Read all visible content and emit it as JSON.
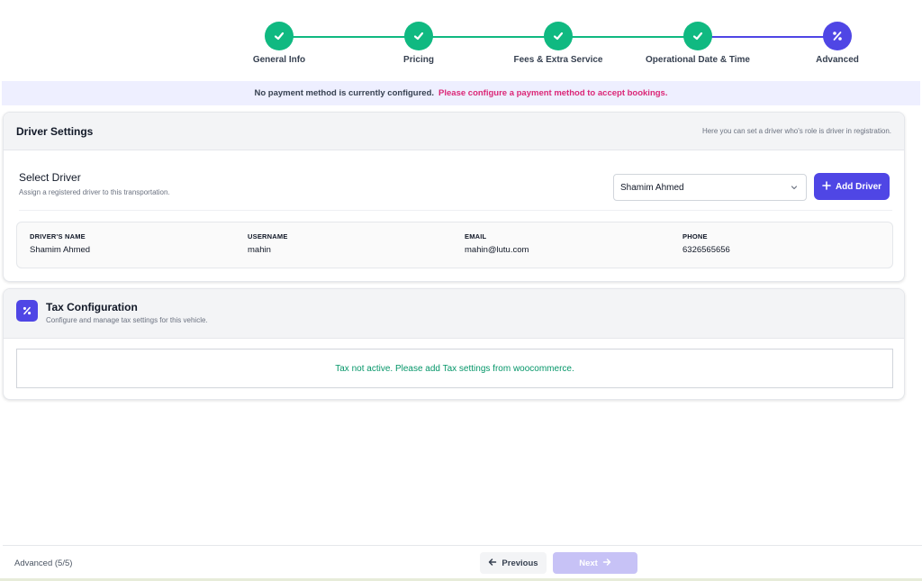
{
  "stepper": {
    "steps": [
      {
        "label": "General Info",
        "status": "done",
        "icon": "check-icon"
      },
      {
        "label": "Pricing",
        "status": "done",
        "icon": "check-icon"
      },
      {
        "label": "Fees & Extra Service",
        "status": "done",
        "icon": "check-icon"
      },
      {
        "label": "Operational Date & Time",
        "status": "done",
        "icon": "check-icon"
      },
      {
        "label": "Advanced",
        "status": "current",
        "icon": "percent-icon"
      }
    ],
    "colors": {
      "done": "#10b981",
      "current": "#4f46e5"
    }
  },
  "notice": {
    "message": "No payment method is currently configured.",
    "link": "Please configure a payment method to accept bookings."
  },
  "driver_settings": {
    "title": "Driver Settings",
    "hint": "Here you can set a driver who's role is driver in registration.",
    "select_title": "Select Driver",
    "select_subtitle": "Assign a registered driver to this transportation.",
    "selected_driver": "Shamim Ahmed",
    "add_button": "Add Driver",
    "table": {
      "headers": [
        "DRIVER'S NAME",
        "USERNAME",
        "EMAIL",
        "PHONE"
      ],
      "values": [
        "Shamim Ahmed",
        "mahin",
        "mahin@lutu.com",
        "6326565656"
      ]
    }
  },
  "tax": {
    "title": "Tax Configuration",
    "subtitle": "Configure and manage tax settings for this vehicle.",
    "message": "Tax not active. Please add Tax settings from woocommerce."
  },
  "footer": {
    "status": "Advanced (5/5)",
    "previous": "Previous",
    "next": "Next"
  },
  "accent_color": "#4f46e5"
}
